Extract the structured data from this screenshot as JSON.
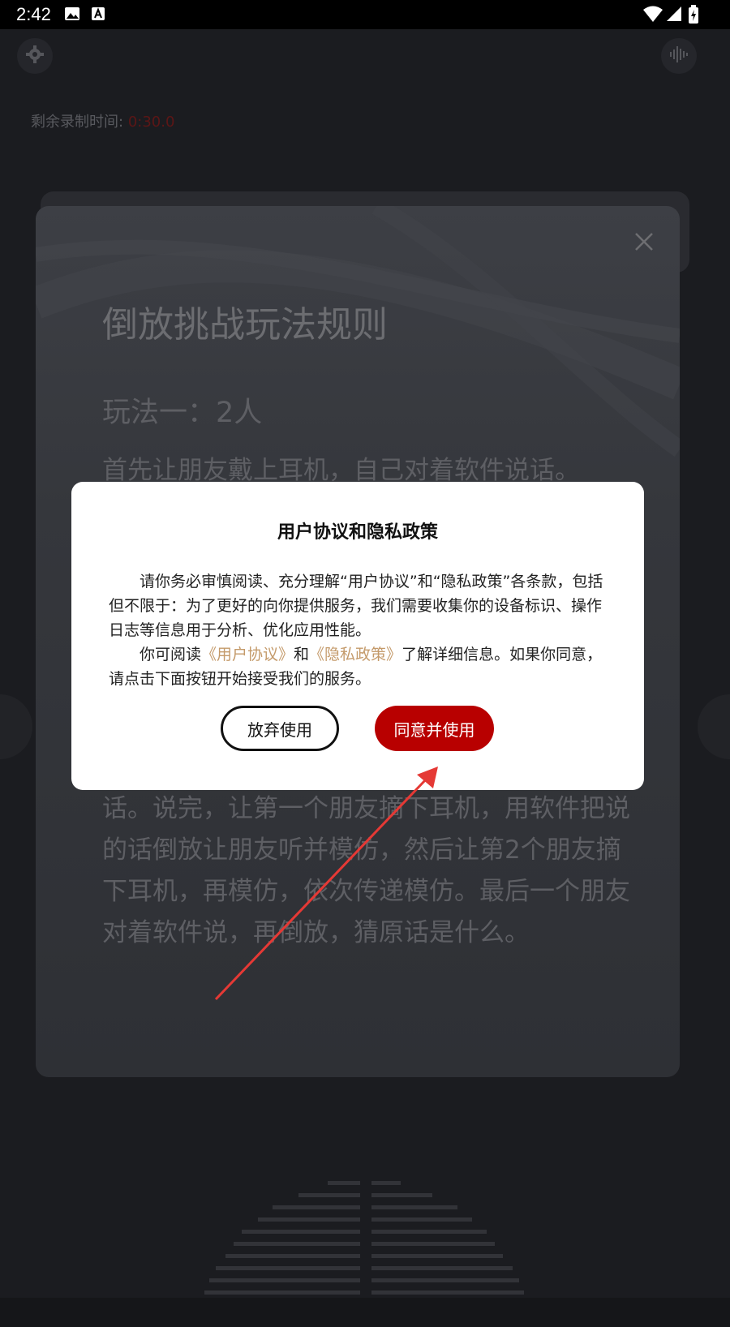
{
  "status_bar": {
    "time": "2:42",
    "icons": [
      "image-icon",
      "a-badge-icon",
      "wifi-icon",
      "signal-icon",
      "battery-charging-icon"
    ]
  },
  "header": {
    "left_icon": "gear-icon",
    "right_icon": "waveform-icon"
  },
  "recording": {
    "label": "剩余录制时间:",
    "value": "0:30.0"
  },
  "rules": {
    "title": "倒放挑战玩法规则",
    "subtitle": "玩法一：2人",
    "text1": "首先让朋友戴上耳机，自己对着软件说话。",
    "text2": "话。说完，让第一个朋友摘下耳机，用软件把说的话倒放让朋友听并模仿，然后让第2个朋友摘下耳机，再模仿，依次传递模仿。最后一个朋友对着软件说，再倒放，猜原话是什么。"
  },
  "dialog": {
    "title": "用户协议和隐私政策",
    "para1": "请你务必审慎阅读、充分理解“用户协议”和“隐私政策”各条款，包括但不限于：为了更好的向你提供服务，我们需要收集你的设备标识、操作日志等信息用于分析、优化应用性能。",
    "para2_prefix": "你可阅读",
    "link_user_agreement": "《用户协议》",
    "para2_and": "和",
    "link_privacy_policy": "《隐私政策》",
    "para2_suffix": "了解详细信息。如果你同意，请点击下面按钮开始接受我们的服务。",
    "decline_label": "放弃使用",
    "agree_label": "同意并使用"
  },
  "colors": {
    "agree_button": "#b80000",
    "link": "#c49a6a",
    "annotation_arrow": "#e53935"
  }
}
